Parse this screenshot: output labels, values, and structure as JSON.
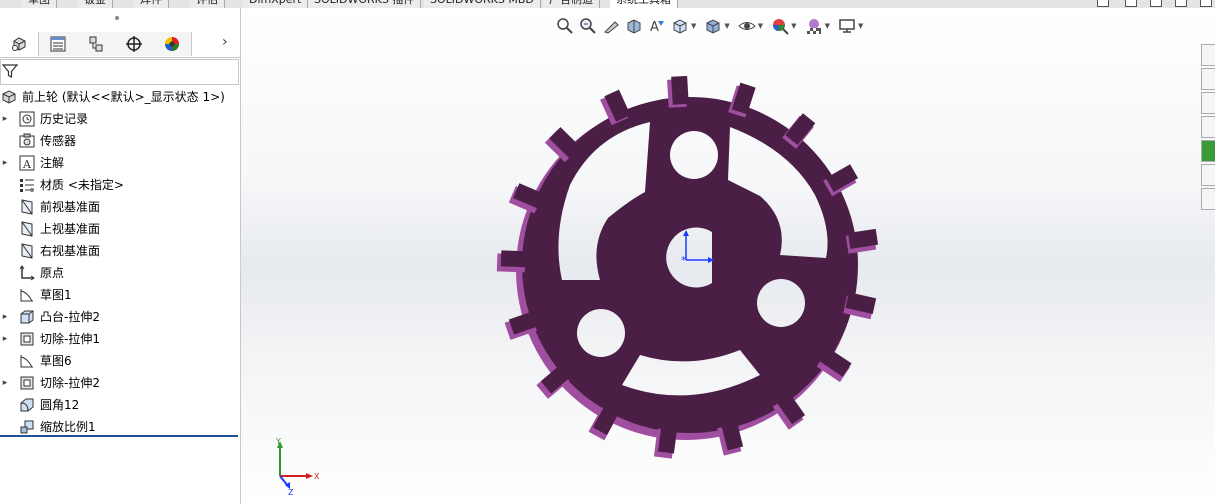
{
  "command_tabs": [
    "草图",
    "钣金",
    "焊件",
    "评估",
    "DimXpert",
    "SOLIDWORKS 插件",
    "SOLIDWORKS MBD",
    "广告制造",
    "系统工具箱"
  ],
  "active_tab_index": 8,
  "panel_tabs": [
    {
      "icon": "feature-manager-icon"
    },
    {
      "icon": "property-manager-icon"
    },
    {
      "icon": "configuration-manager-icon"
    },
    {
      "icon": "dimxpert-manager-icon"
    },
    {
      "icon": "display-manager-icon"
    }
  ],
  "panel_more": "›",
  "feature_tree": {
    "root": "前上轮  (默认<<默认>_显示状态 1>)",
    "items": [
      {
        "label": "历史记录",
        "icon": "history-icon",
        "expandable": true
      },
      {
        "label": "传感器",
        "icon": "sensor-icon",
        "expandable": false
      },
      {
        "label": "注解",
        "icon": "annotation-icon",
        "expandable": true
      },
      {
        "label": "材质 <未指定>",
        "icon": "material-icon",
        "expandable": false
      },
      {
        "label": "前视基准面",
        "icon": "plane-icon",
        "expandable": false
      },
      {
        "label": "上视基准面",
        "icon": "plane-icon",
        "expandable": false
      },
      {
        "label": "右视基准面",
        "icon": "plane-icon",
        "expandable": false
      },
      {
        "label": "原点",
        "icon": "origin-icon",
        "expandable": false
      },
      {
        "label": "草图1",
        "icon": "sketch-icon",
        "expandable": false
      },
      {
        "label": "凸台-拉伸2",
        "icon": "boss-extrude-icon",
        "expandable": true
      },
      {
        "label": "切除-拉伸1",
        "icon": "cut-extrude-icon",
        "expandable": true
      },
      {
        "label": "草图6",
        "icon": "sketch-icon",
        "expandable": false
      },
      {
        "label": "切除-拉伸2",
        "icon": "cut-extrude-icon",
        "expandable": true
      },
      {
        "label": "圆角12",
        "icon": "fillet-icon",
        "expandable": false
      },
      {
        "label": "缩放比例1",
        "icon": "scale-icon",
        "expandable": false
      }
    ]
  },
  "headsup_toolbar": [
    "zoom-to-fit-icon",
    "zoom-to-area-icon",
    "previous-view-icon",
    "section-view-icon",
    "dynamic-annotation-icon",
    "view-orientation-icon",
    "display-style-icon",
    "hide-show-items-icon",
    "edit-appearance-icon",
    "apply-scene-icon",
    "view-settings-icon"
  ],
  "task_pane": [
    "home-icon",
    "parts-icon",
    "file-explorer-icon",
    "view-palette-icon",
    "appearances-icon",
    "custom-properties-icon",
    "forum-icon"
  ],
  "triad": {
    "x": "X",
    "y": "Y",
    "z": "Z"
  },
  "colors": {
    "part": "#4a1e45",
    "part_edge": "#a04ea0",
    "origin": "#1a3cff",
    "selection_bar": "#1f4e9a"
  }
}
